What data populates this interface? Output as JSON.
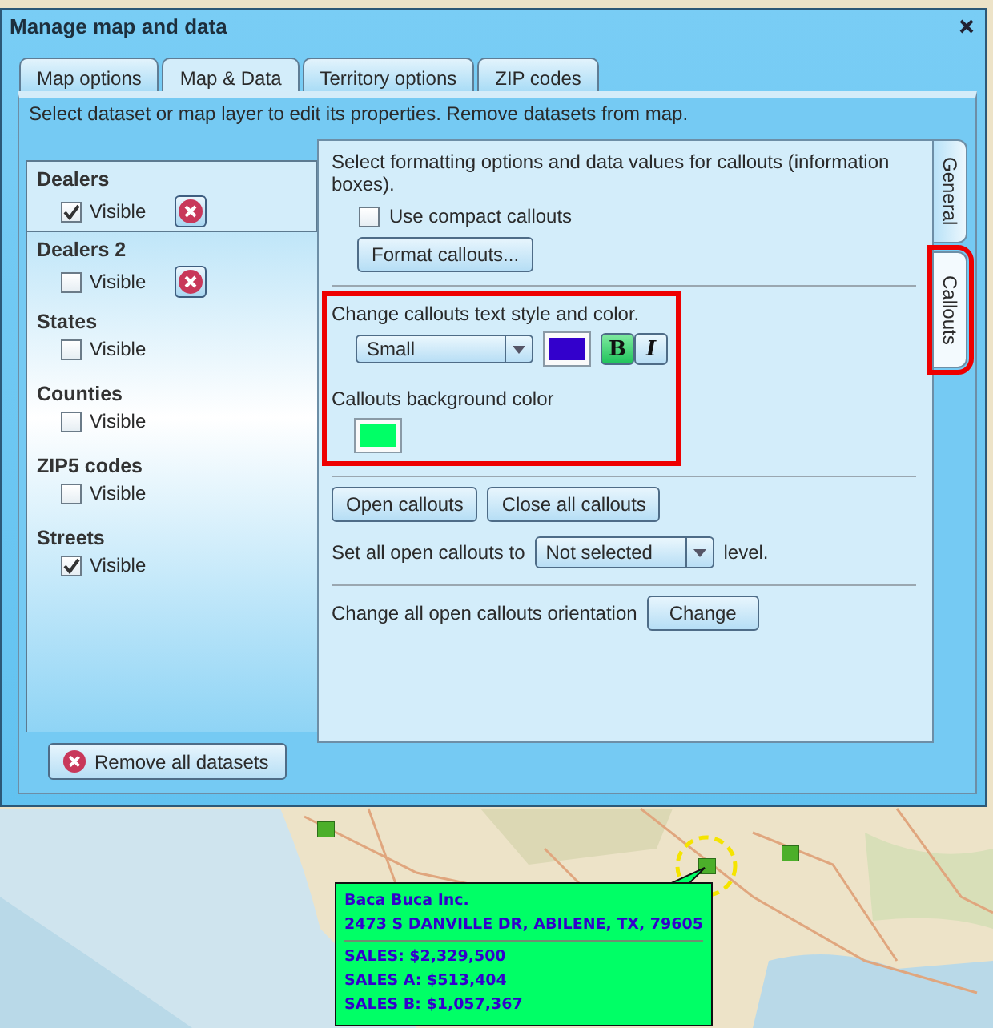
{
  "window": {
    "title": "Manage map and data"
  },
  "tabs": [
    {
      "label": "Map options",
      "selected": false
    },
    {
      "label": "Map & Data",
      "selected": true
    },
    {
      "label": "Territory options",
      "selected": false
    },
    {
      "label": "ZIP codes",
      "selected": false
    }
  ],
  "instructions": "Select dataset or map layer to edit its properties. Remove datasets from map.",
  "datasets": [
    {
      "name": "Dealers",
      "selected": true,
      "visible_label": "Visible",
      "visible": true,
      "removable": true
    },
    {
      "name": "Dealers 2",
      "selected": false,
      "visible_label": "Visible",
      "visible": false,
      "removable": true
    },
    {
      "name": "States",
      "selected": false,
      "visible_label": "Visible",
      "visible": false,
      "removable": false
    },
    {
      "name": "Counties",
      "selected": false,
      "visible_label": "Visible",
      "visible": false,
      "removable": false
    },
    {
      "name": "ZIP5 codes",
      "selected": false,
      "visible_label": "Visible",
      "visible": false,
      "removable": false
    },
    {
      "name": "Streets",
      "selected": false,
      "visible_label": "Visible",
      "visible": true,
      "removable": false
    }
  ],
  "side_tabs": [
    {
      "label": "General",
      "selected": false,
      "highlighted": false
    },
    {
      "label": "Callouts",
      "selected": true,
      "highlighted": true
    }
  ],
  "callouts_panel": {
    "intro": "Select formatting options and data values for callouts (information boxes).",
    "compact": {
      "label": "Use compact callouts",
      "checked": false
    },
    "format_button": "Format callouts...",
    "style_section": {
      "highlighted": true,
      "label": "Change callouts text style and color.",
      "size": "Small",
      "text_swatch": {
        "color": "#3300cc"
      },
      "bold": {
        "label": "B",
        "on": true
      },
      "italic": {
        "label": "I",
        "on": false
      },
      "background_label": "Callouts background color",
      "background_swatch": {
        "color": "#00ff66"
      }
    },
    "open_button": "Open callouts",
    "close_button": "Close all callouts",
    "level_prefix": "Set all open callouts to",
    "level_value": "Not selected",
    "level_suffix": "level.",
    "orientation_label": "Change all open callouts orientation",
    "orientation_button": "Change"
  },
  "remove_all_button": "Remove all datasets",
  "map": {
    "callout": {
      "title": "Baca Buca Inc.",
      "address": "2473 S DANVILLE DR, ABILENE, TX, 79605",
      "lines": [
        "SALES: $2,329,500",
        "SALES A: $513,404",
        "SALES B: $1,057,367"
      ]
    }
  }
}
